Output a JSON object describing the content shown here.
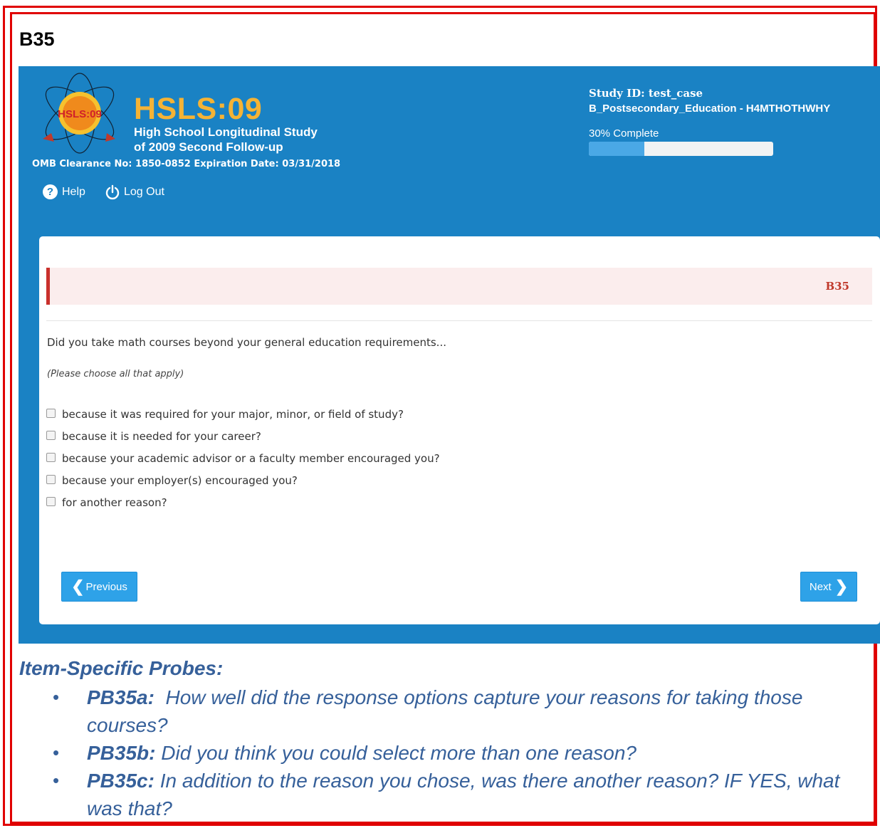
{
  "page": {
    "label": "B35"
  },
  "header": {
    "logo_text": "HSLS:09",
    "title": "HSLS:09",
    "subtitle_line1": "High School Longitudinal Study",
    "subtitle_line2": "of 2009 Second Follow-up",
    "omb": "OMB Clearance No: 1850-0852 Expiration Date: 03/31/2018",
    "nav": {
      "help": "Help",
      "logout": "Log Out"
    },
    "study_id": "Study ID: test_case",
    "section_code": "B_Postsecondary_Education - H4MTHOTHWHY",
    "progress_label": "30% Complete",
    "progress_value": 0.3
  },
  "question": {
    "code": "B35",
    "text": "Did you take math courses beyond your general education requirements...",
    "instruction": "(Please choose all that apply)",
    "options": [
      "because it was required for your major, minor, or field of study?",
      "because it is needed for your career?",
      "because your academic advisor or a faculty member encouraged you?",
      "because your employer(s) encouraged you?",
      "for another reason?"
    ]
  },
  "buttons": {
    "previous": "Previous",
    "next": "Next"
  },
  "probes": {
    "title": "Item-Specific Probes:",
    "items": [
      {
        "id": "PB35a:",
        "text": "How well did the response options capture your reasons for taking those courses?"
      },
      {
        "id": "PB35b:",
        "text": "Did you think you could select more than one reason?"
      },
      {
        "id": "PB35c:",
        "text": "In addition to the reason you chose, was there another reason? IF YES, what was that?"
      }
    ]
  },
  "colors": {
    "header_blue": "#1a82c4",
    "title_gold": "#f5b335",
    "frame_red": "#e00000",
    "probe_blue": "#36609a"
  }
}
